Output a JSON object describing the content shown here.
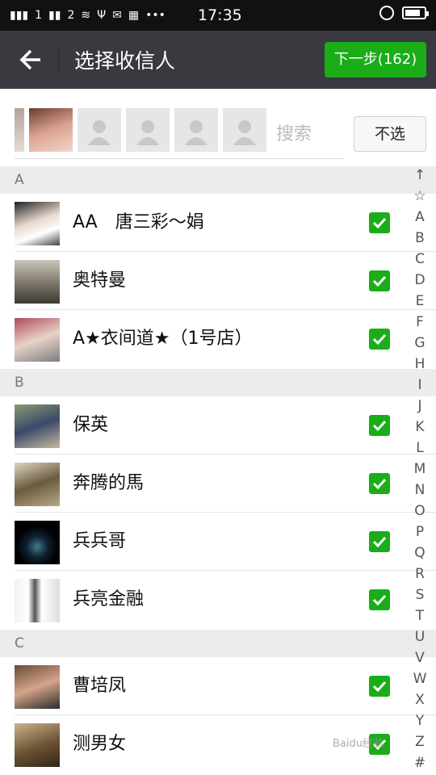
{
  "status": {
    "time": "17:35",
    "sim1": "1",
    "sim2": "2",
    "more": "•••"
  },
  "header": {
    "title": "选择收信人",
    "next_button": "下一步(162)",
    "back_icon": "arrow-left-icon"
  },
  "search": {
    "placeholder": "搜索",
    "deselect_button": "不选"
  },
  "sections": [
    {
      "letter": "A",
      "contacts": [
        {
          "name": "AA　唐三彩～娟",
          "checked": true
        },
        {
          "name": "奥特曼",
          "checked": true
        },
        {
          "name": "A★衣间道★（1号店）",
          "checked": true
        }
      ]
    },
    {
      "letter": "B",
      "contacts": [
        {
          "name": "保英",
          "checked": true
        },
        {
          "name": "奔腾的馬",
          "checked": true
        },
        {
          "name": "兵兵哥",
          "checked": true
        },
        {
          "name": "兵亮金融",
          "checked": true
        }
      ]
    },
    {
      "letter": "C",
      "contacts": [
        {
          "name": "曹培凤",
          "checked": true
        },
        {
          "name": "测男女",
          "checked": true
        }
      ]
    }
  ],
  "index_letters": [
    "↑",
    "☆",
    "A",
    "B",
    "C",
    "D",
    "E",
    "F",
    "G",
    "H",
    "I",
    "J",
    "K",
    "L",
    "M",
    "N",
    "O",
    "P",
    "Q",
    "R",
    "S",
    "T",
    "U",
    "V",
    "W",
    "X",
    "Y",
    "Z",
    "#"
  ],
  "watermark": "Baidu经验",
  "colors": {
    "accent": "#1aad19",
    "topbar": "#393a3f"
  }
}
